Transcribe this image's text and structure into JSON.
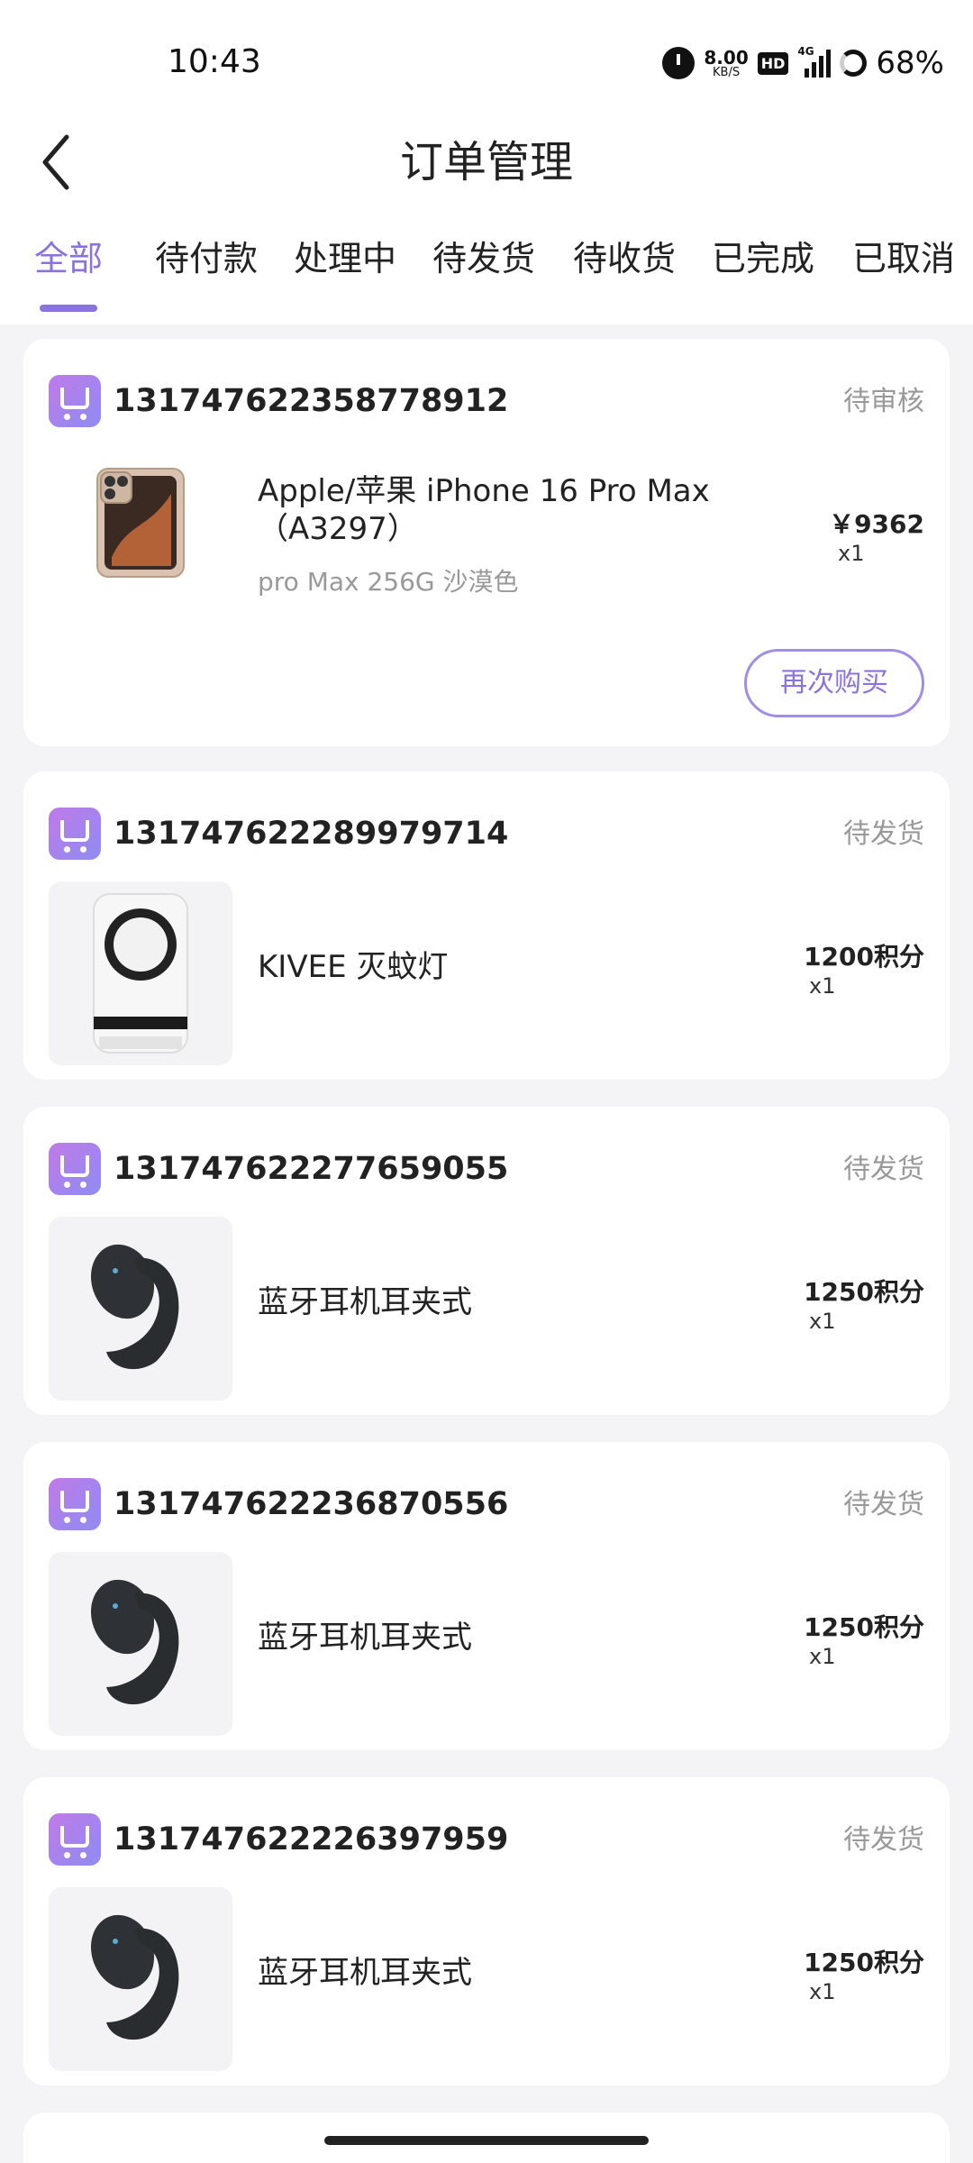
{
  "status_bar": {
    "time": "10:43",
    "net_speed": "8.00",
    "net_unit": "KB/S",
    "hd": "HD",
    "network": "4G",
    "battery": "68%"
  },
  "header": {
    "title": "订单管理"
  },
  "tabs": [
    {
      "label": "全部",
      "active": true
    },
    {
      "label": "待付款"
    },
    {
      "label": "处理中"
    },
    {
      "label": "待发货"
    },
    {
      "label": "待收货"
    },
    {
      "label": "已完成"
    },
    {
      "label": "已取消"
    }
  ],
  "orders": [
    {
      "order_no": "131747622358778912",
      "status": "待审核",
      "product_name_line1": "Apple/苹果 iPhone 16 Pro Max",
      "product_name_line2": "（A3297）",
      "spec": "pro Max 256G 沙漠色",
      "price": "￥9362",
      "qty": "x1",
      "action": "再次购买"
    },
    {
      "order_no": "131747622289979714",
      "status": "待发货",
      "product_name": "KIVEE 灭蚊灯",
      "price": "1200积分",
      "qty": "x1"
    },
    {
      "order_no": "131747622277659055",
      "status": "待发货",
      "product_name": "蓝牙耳机耳夹式",
      "price": "1250积分",
      "qty": "x1"
    },
    {
      "order_no": "131747622236870556",
      "status": "待发货",
      "product_name": "蓝牙耳机耳夹式",
      "price": "1250积分",
      "qty": "x1"
    },
    {
      "order_no": "131747622226397959",
      "status": "待发货",
      "product_name": "蓝牙耳机耳夹式",
      "price": "1250积分",
      "qty": "x1"
    }
  ],
  "colors": {
    "accent": "#8a72e0",
    "background": "#f4f4f6"
  }
}
